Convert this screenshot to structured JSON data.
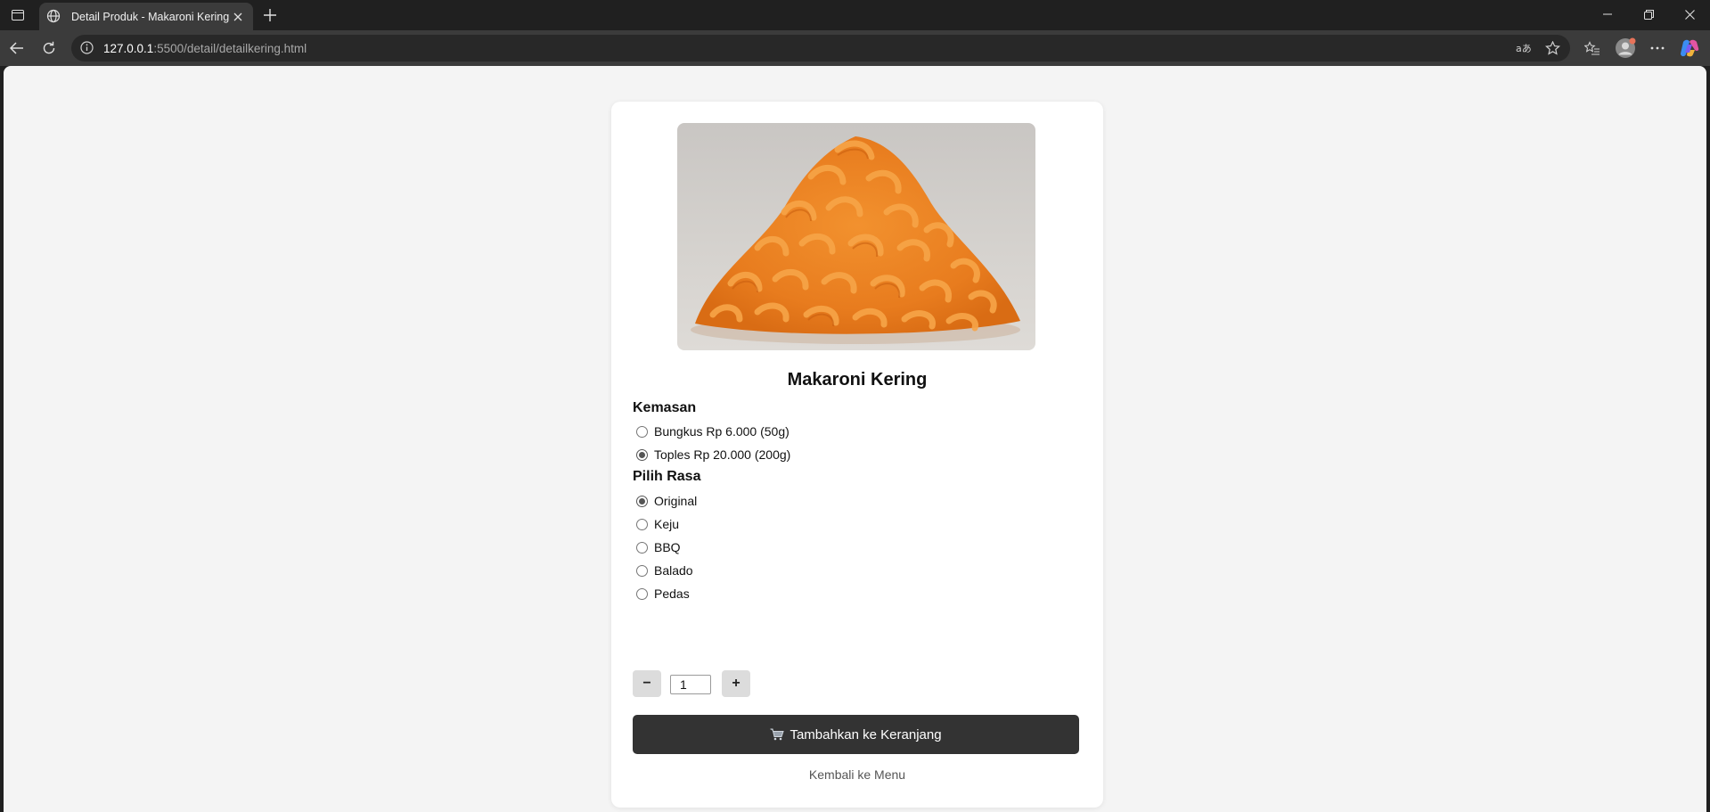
{
  "browser": {
    "tab_title": "Detail Produk - Makaroni Kering",
    "url_host": "127.0.0.1",
    "url_rest": ":5500/detail/detailkering.html"
  },
  "product": {
    "title": "Makaroni Kering",
    "image_icon": "macaroni-snack-image"
  },
  "packaging": {
    "label": "Kemasan",
    "options": [
      {
        "label": "Bungkus Rp 6.000 (50g)",
        "selected": false
      },
      {
        "label": "Toples Rp 20.000 (200g)",
        "selected": true
      }
    ]
  },
  "flavor": {
    "label": "Pilih Rasa",
    "options": [
      {
        "label": "Original",
        "selected": true
      },
      {
        "label": "Keju",
        "selected": false
      },
      {
        "label": "BBQ",
        "selected": false
      },
      {
        "label": "Balado",
        "selected": false
      },
      {
        "label": "Pedas",
        "selected": false
      }
    ]
  },
  "quantity": {
    "minus_label": "−",
    "value": "1",
    "plus_label": "+"
  },
  "actions": {
    "add_to_cart": "Tambahkan ke Keranjang",
    "back": "Kembali ke Menu"
  },
  "colors": {
    "button_dark": "#333333",
    "page_bg": "#f4f4f4",
    "card_bg": "#ffffff"
  }
}
